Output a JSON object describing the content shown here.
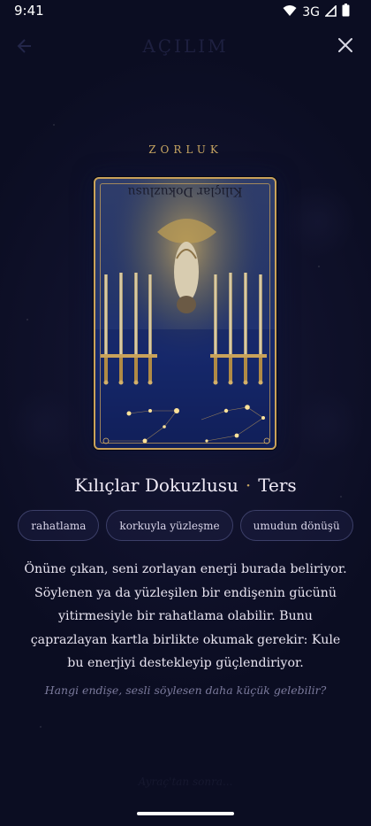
{
  "status_bar": {
    "time": "9:41",
    "network": "3G",
    "icons": [
      "wifi-icon",
      "cell-signal-icon",
      "battery-icon"
    ]
  },
  "app_bar": {
    "title": "AÇILIM",
    "back_icon": "arrow-left-icon",
    "close_icon": "close-icon"
  },
  "position_label": "ZORLUK",
  "card": {
    "title_upside_down": "Kılıçlar Dokuzlusu",
    "orientation": "reversed"
  },
  "card_name": {
    "name": "Kılıçlar Dokuzlusu",
    "separator": "·",
    "orientation_label": "Ters"
  },
  "tags": [
    {
      "label": "rahatlama"
    },
    {
      "label": "korkuyla yüzleşme"
    },
    {
      "label": "umudun dönüşü"
    }
  ],
  "description": "Önüne çıkan, seni zorlayan enerji burada beliriyor. Söylenen ya da yüzleşilen bir endişenin gücünü yitirmesiyle bir rahatlama olabilir. Bunu çaprazlayan kartla birlikte okumak gerekir: Kule bu enerjiyi destekleyip güçlendiriyor.",
  "question": "Hangi endişe, sesli söylesen daha küçük gelebilir?",
  "footer_text": "Ayraç'tan sonra...",
  "colors": {
    "background": "#0b0d22",
    "accent_gold": "#c8a662",
    "tag_border": "#3c3f68",
    "text": "#e8e4f0",
    "muted": "#7b7a9c"
  }
}
